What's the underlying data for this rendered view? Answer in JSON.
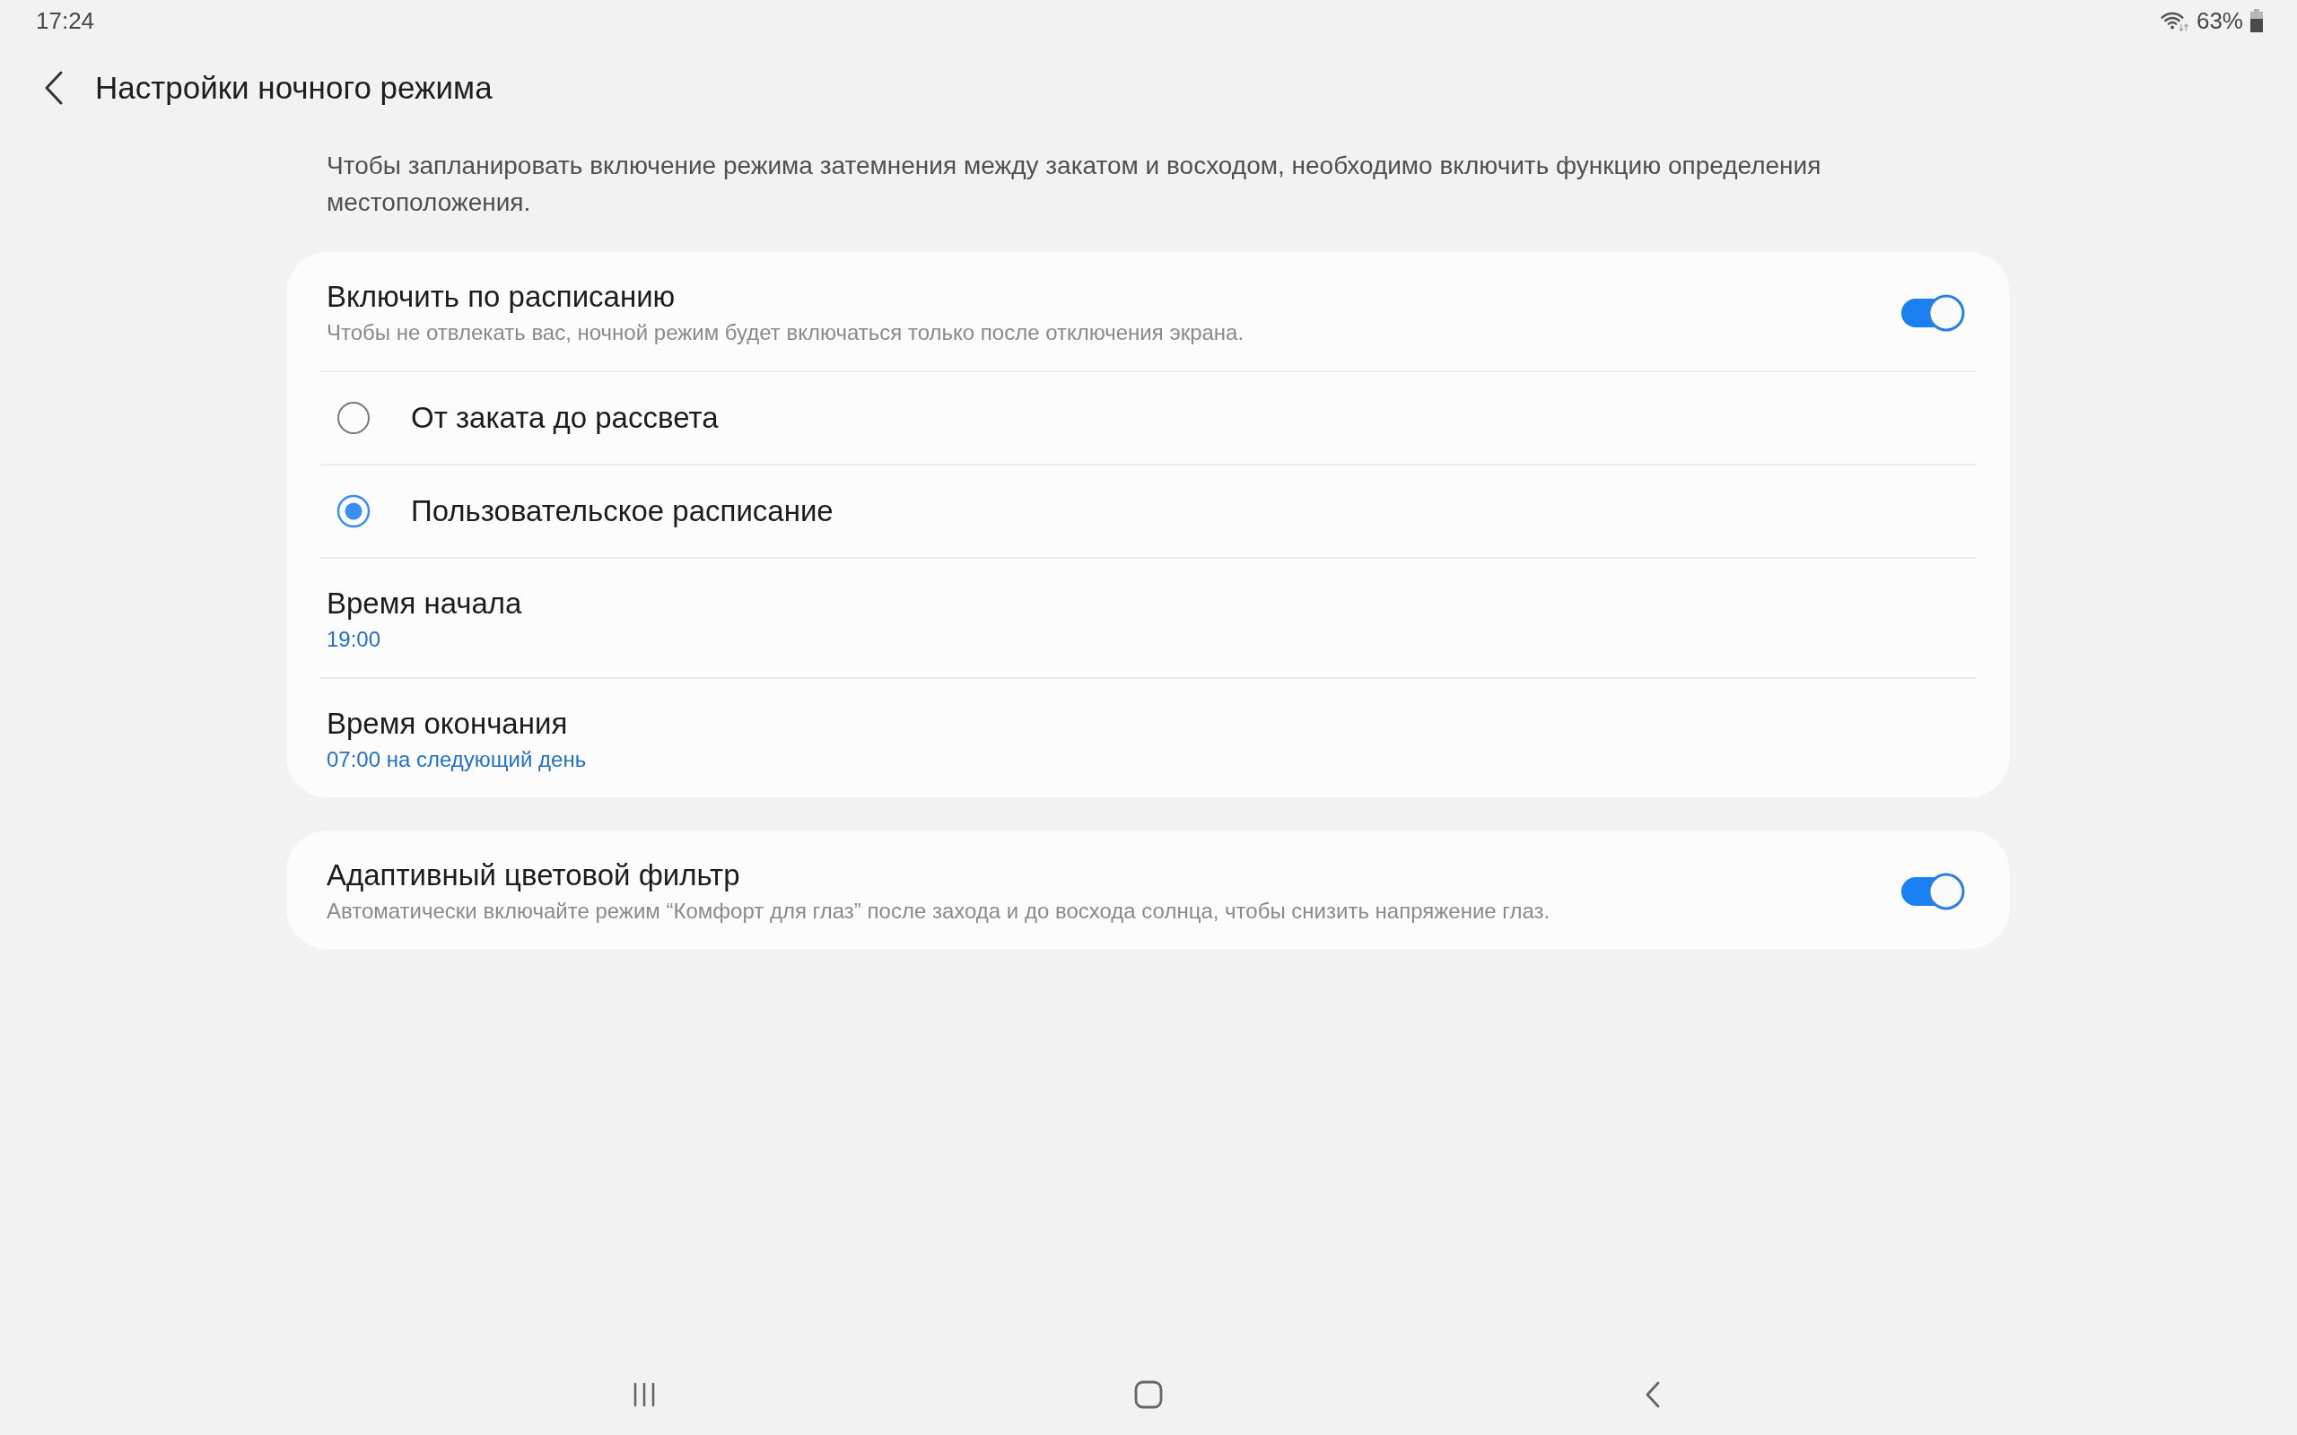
{
  "status_bar": {
    "time": "17:24",
    "battery": "63%"
  },
  "header": {
    "title": "Настройки ночного режима"
  },
  "notice": "Чтобы запланировать включение режима затемнения между закатом и восходом, необходимо включить функцию определения местоположения.",
  "schedule_card": {
    "title": "Включить по расписанию",
    "subtitle": "Чтобы не отвлекать вас, ночной режим будет включаться только после отключения экрана.",
    "on": true,
    "options": [
      {
        "label": "От заката до рассвета",
        "selected": false
      },
      {
        "label": "Пользовательское расписание",
        "selected": true
      }
    ],
    "times": [
      {
        "title": "Время начала",
        "value": "19:00"
      },
      {
        "title": "Время окончания",
        "value": "07:00 на следующий день"
      }
    ]
  },
  "adaptive_filter": {
    "title": "Адаптивный цветовой фильтр",
    "subtitle": "Автоматически включайте режим “Комфорт для глаз” после захода и до восхода солнца, чтобы снизить напряжение глаз.",
    "on": true
  }
}
